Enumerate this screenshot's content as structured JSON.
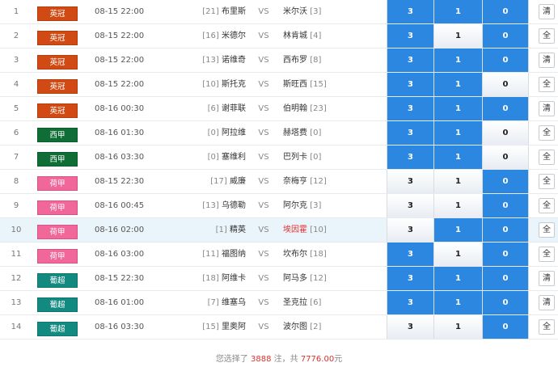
{
  "matches": [
    {
      "num": "1",
      "league": "英冠",
      "league_color": "#d24a13",
      "time": "08-15 22:00",
      "home_rank": "[21]",
      "home": "布里斯",
      "vs": "VS",
      "away": "米尔沃",
      "away_rank": "[3]",
      "away_red": false,
      "odds": [
        "3",
        "1",
        "0"
      ],
      "selected": [
        true,
        true,
        true
      ],
      "action": "清",
      "highlight": false
    },
    {
      "num": "2",
      "league": "英冠",
      "league_color": "#d24a13",
      "time": "08-15 22:00",
      "home_rank": "[16]",
      "home": "米德尔",
      "vs": "VS",
      "away": "林肯城",
      "away_rank": "[4]",
      "away_red": false,
      "odds": [
        "3",
        "1",
        "0"
      ],
      "selected": [
        true,
        false,
        true
      ],
      "action": "全",
      "highlight": false
    },
    {
      "num": "3",
      "league": "英冠",
      "league_color": "#d24a13",
      "time": "08-15 22:00",
      "home_rank": "[13]",
      "home": "诺维奇",
      "vs": "VS",
      "away": "西布罗",
      "away_rank": "[8]",
      "away_red": false,
      "odds": [
        "3",
        "1",
        "0"
      ],
      "selected": [
        true,
        true,
        true
      ],
      "action": "清",
      "highlight": false
    },
    {
      "num": "4",
      "league": "英冠",
      "league_color": "#d24a13",
      "time": "08-15 22:00",
      "home_rank": "[10]",
      "home": "斯托克",
      "vs": "VS",
      "away": "斯旺西",
      "away_rank": "[15]",
      "away_red": false,
      "odds": [
        "3",
        "1",
        "0"
      ],
      "selected": [
        true,
        true,
        false
      ],
      "action": "全",
      "highlight": false
    },
    {
      "num": "5",
      "league": "英冠",
      "league_color": "#d24a13",
      "time": "08-16 00:30",
      "home_rank": "[6]",
      "home": "谢菲联",
      "vs": "VS",
      "away": "伯明翰",
      "away_rank": "[23]",
      "away_red": false,
      "odds": [
        "3",
        "1",
        "0"
      ],
      "selected": [
        true,
        true,
        true
      ],
      "action": "清",
      "highlight": false
    },
    {
      "num": "6",
      "league": "西甲",
      "league_color": "#0f6e35",
      "time": "08-16 01:30",
      "home_rank": "[0]",
      "home": "阿拉维",
      "vs": "VS",
      "away": "赫塔费",
      "away_rank": "[0]",
      "away_red": false,
      "odds": [
        "3",
        "1",
        "0"
      ],
      "selected": [
        true,
        true,
        false
      ],
      "action": "全",
      "highlight": false
    },
    {
      "num": "7",
      "league": "西甲",
      "league_color": "#0f6e35",
      "time": "08-16 03:30",
      "home_rank": "[0]",
      "home": "塞维利",
      "vs": "VS",
      "away": "巴列卡",
      "away_rank": "[0]",
      "away_red": false,
      "odds": [
        "3",
        "1",
        "0"
      ],
      "selected": [
        true,
        true,
        false
      ],
      "action": "全",
      "highlight": false
    },
    {
      "num": "8",
      "league": "荷甲",
      "league_color": "#f2679a",
      "time": "08-15 22:30",
      "home_rank": "[17]",
      "home": "威廉",
      "vs": "VS",
      "away": "奈梅亨",
      "away_rank": "[12]",
      "away_red": false,
      "odds": [
        "3",
        "1",
        "0"
      ],
      "selected": [
        false,
        false,
        true
      ],
      "action": "全",
      "highlight": false
    },
    {
      "num": "9",
      "league": "荷甲",
      "league_color": "#f2679a",
      "time": "08-16 00:45",
      "home_rank": "[13]",
      "home": "乌德勒",
      "vs": "VS",
      "away": "阿尔克",
      "away_rank": "[3]",
      "away_red": false,
      "odds": [
        "3",
        "1",
        "0"
      ],
      "selected": [
        false,
        false,
        true
      ],
      "action": "全",
      "highlight": false
    },
    {
      "num": "10",
      "league": "荷甲",
      "league_color": "#f2679a",
      "time": "08-16 02:00",
      "home_rank": "[1]",
      "home": "精英",
      "vs": "VS",
      "away": "埃因霍",
      "away_rank": "[10]",
      "away_red": true,
      "odds": [
        "3",
        "1",
        "0"
      ],
      "selected": [
        false,
        true,
        true
      ],
      "action": "全",
      "highlight": true
    },
    {
      "num": "11",
      "league": "荷甲",
      "league_color": "#f2679a",
      "time": "08-16 03:00",
      "home_rank": "[11]",
      "home": "福图纳",
      "vs": "VS",
      "away": "坎布尔",
      "away_rank": "[18]",
      "away_red": false,
      "odds": [
        "3",
        "1",
        "0"
      ],
      "selected": [
        true,
        false,
        true
      ],
      "action": "全",
      "highlight": false
    },
    {
      "num": "12",
      "league": "葡超",
      "league_color": "#138a80",
      "time": "08-15 22:30",
      "home_rank": "[18]",
      "home": "阿维卡",
      "vs": "VS",
      "away": "阿马多",
      "away_rank": "[12]",
      "away_red": false,
      "odds": [
        "3",
        "1",
        "0"
      ],
      "selected": [
        true,
        true,
        true
      ],
      "action": "清",
      "highlight": false
    },
    {
      "num": "13",
      "league": "葡超",
      "league_color": "#138a80",
      "time": "08-16 01:00",
      "home_rank": "[7]",
      "home": "维塞乌",
      "vs": "VS",
      "away": "圣克拉",
      "away_rank": "[6]",
      "away_red": false,
      "odds": [
        "3",
        "1",
        "0"
      ],
      "selected": [
        true,
        true,
        true
      ],
      "action": "清",
      "highlight": false
    },
    {
      "num": "14",
      "league": "葡超",
      "league_color": "#138a80",
      "time": "08-16 03:30",
      "home_rank": "[15]",
      "home": "里奥阿",
      "vs": "VS",
      "away": "波尔图",
      "away_rank": "[2]",
      "away_red": false,
      "odds": [
        "3",
        "1",
        "0"
      ],
      "selected": [
        false,
        false,
        true
      ],
      "action": "全",
      "highlight": false
    }
  ],
  "summary": {
    "prefix": "您选择了",
    "count": "3888",
    "mid": "注，共",
    "amount": "7776.00",
    "suffix": "元"
  },
  "colors": {
    "selected": "#2c87e0",
    "highlight_row": "#eaf4fb",
    "red_text": "#e03030"
  }
}
